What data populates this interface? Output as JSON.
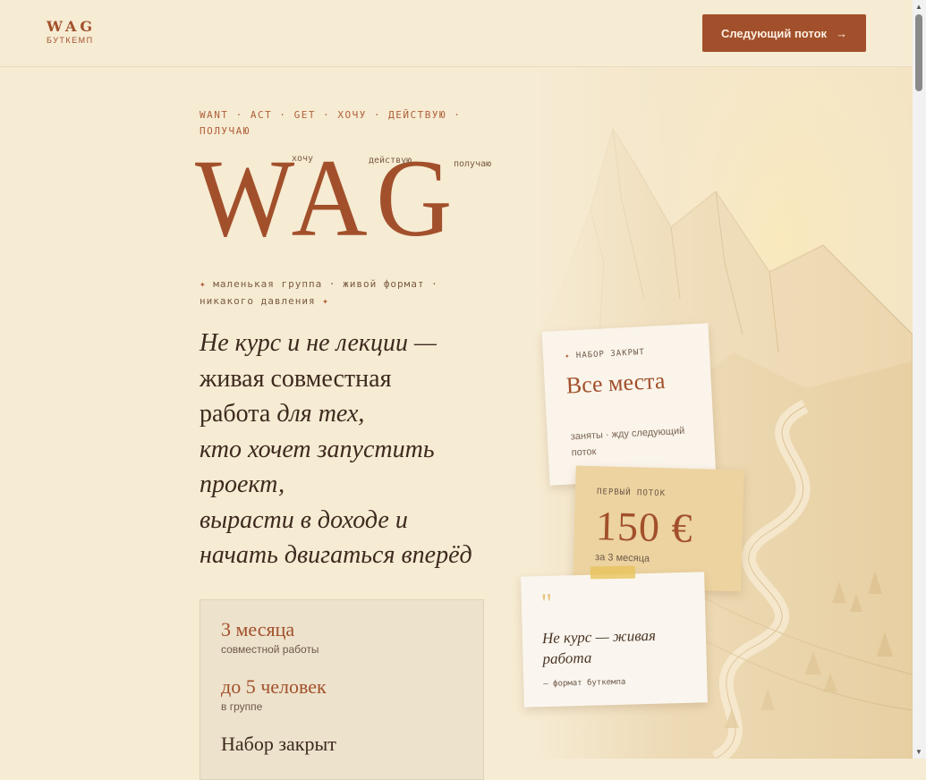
{
  "header": {
    "logo_main": "WAG",
    "logo_sub": "БУТКЕМП",
    "cta_label": "Следующий поток",
    "cta_arrow": "→"
  },
  "hero": {
    "eyebrow": "WANT · ACT · GET · ХОЧУ · ДЕЙСТВУЮ · ПОЛУЧАЮ",
    "word": "WAG",
    "notes": [
      "хочу",
      "действую",
      "получаю"
    ],
    "tagline_star": "✦",
    "tagline": "маленькая группа · живой формат · никакого давления",
    "headline_1": "Не курс и не лекции —",
    "headline_2": "живая совместная",
    "headline_3a": "работа",
    "headline_3b": " для тех,",
    "headline_4": "кто хочет запустить",
    "headline_5": "проект,",
    "headline_6": "вырасти в доходе и",
    "headline_7": "начать двигаться вперёд"
  },
  "facts": [
    {
      "value": "3 месяца",
      "label": "совместной работы"
    },
    {
      "value": "до 5 человек",
      "label": "в группе"
    },
    {
      "value": "Набор закрыт",
      "label": ""
    }
  ],
  "cards": {
    "status": {
      "label_star": "✦",
      "label": "НАБОР ЗАКРЫТ",
      "title": "Все места",
      "sub": "заняты · жду следующий поток"
    },
    "price": {
      "label": "ПЕРВЫЙ ПОТОК",
      "value": "150 €",
      "sub": "за 3 месяца"
    },
    "quote": {
      "mark": "\"",
      "text": "Не курс — живая работа",
      "source": "— формат буткемпа"
    }
  },
  "colors": {
    "background": "#f6ebd3",
    "accent": "#a2502b",
    "text": "#3d2a1e",
    "price_card": "#ecd3a0"
  }
}
